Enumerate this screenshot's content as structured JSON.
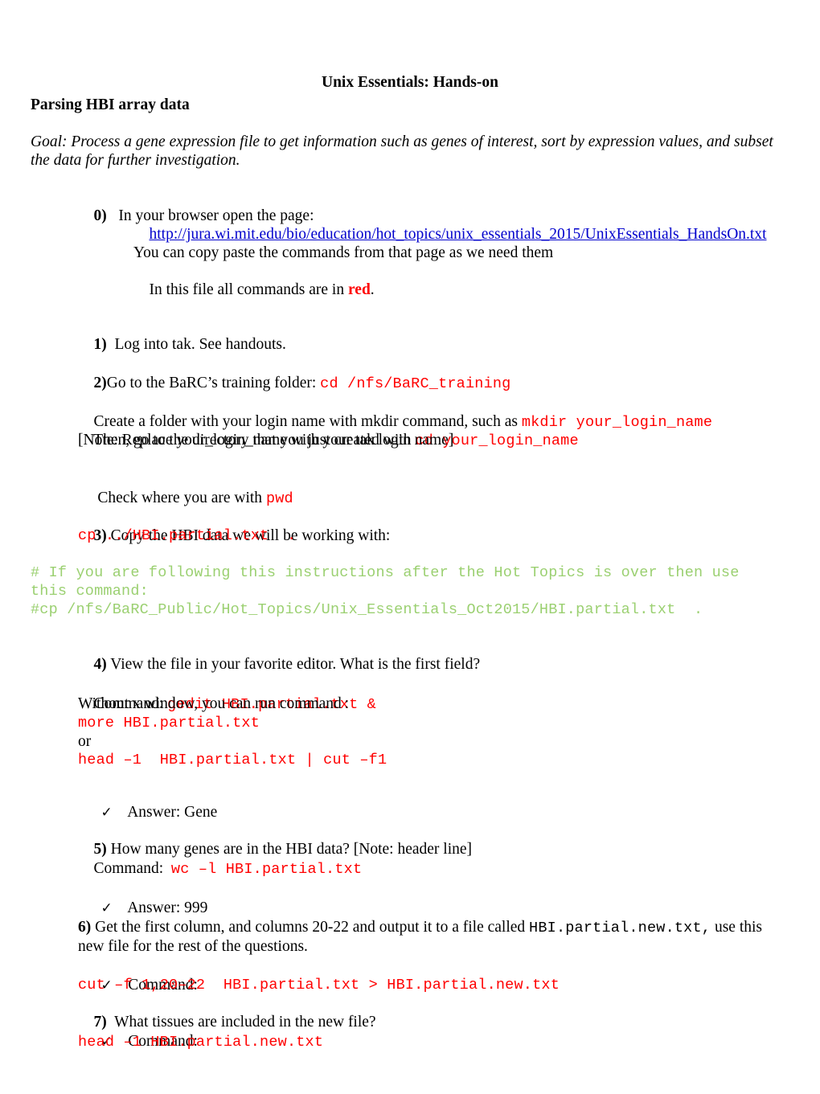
{
  "document": {
    "title": "Unix Essentials: Hands-on",
    "subtitle": "Parsing HBI array data",
    "goal_line1": "Goal: Process a gene expression file to get information such as genes of interest, sort by expression values, and subset",
    "goal_line2": "the data for further investigation."
  },
  "colors": {
    "command_red": "#FF0000",
    "comment_green": "#9BD071",
    "hyperlink_blue": "#0000CC",
    "body_black": "#000000"
  },
  "icons": {
    "checkmark": "✓"
  },
  "steps": {
    "step0": {
      "number": "0)",
      "text": "In your browser open the page:",
      "url": "http://jura.wi.mit.edu/bio/education/hot_topics/unix_essentials_2015/UnixEssentials_HandsOn.txt",
      "note1": "You can copy paste the commands from that page as we need them",
      "note2_prefix": "In this file all commands are in ",
      "note2_red": "red",
      "note2_suffix": "."
    },
    "step1": {
      "number": "1)",
      "text": "Log into tak. See handouts."
    },
    "step2": {
      "number": "2)",
      "text": "Go to the BaRC’s training folder: ",
      "command": "cd /nfs/BaRC_training",
      "line_create_prefix": "Create a folder with your login name with mkdir command, such as ",
      "line_create_cmd": "mkdir your_login_name",
      "line_then_prefix": "Then, go to the directory that you just created with ",
      "line_then_cmd": "cd your_login_name",
      "line_note": "[Note: Replace your_login_name with your tak login name]",
      "line_check_prefix": " Check where you are with ",
      "line_check_cmd": "pwd"
    },
    "step3": {
      "number": "3)",
      "text": "Copy the HBI data we will be working with:",
      "command": "cp ../HBI.partial.txt  .",
      "comment_line1": "# If you are following this instructions after the Hot Topics is over then use",
      "comment_line2": "this command:",
      "comment_line3": "#cp /nfs/BaRC_Public/Hot_Topics/Unix_Essentials_Oct2015/HBI.partial.txt  ."
    },
    "step4": {
      "number": "4)",
      "text": "View the file in your favorite editor. What is the first field?",
      "command_label": "Command: ",
      "command": "gedit HBI.partial.txt &",
      "without_x": "Without x window, you can run command :",
      "command_more": "more HBI.partial.txt",
      "or_label": "or",
      "command_head": "head –1  HBI.partial.txt | cut –f1",
      "answer": "Answer: Gene"
    },
    "step5": {
      "number": "5)",
      "text": "How many genes are in the HBI data? [Note: header line]",
      "command_label": "Command:  ",
      "command": "wc –l HBI.partial.txt",
      "answer": "Answer: 999"
    },
    "step6": {
      "number": "6)",
      "text_part1": "Get the first column, and columns 20-22 and output it to a file called ",
      "text_mono": "HBI.partial.new.txt,",
      "text_part2": " use this",
      "text_line2": "new file for the rest of the questions.",
      "command_label": "Command:",
      "command": "cut –f 1,20–22  HBI.partial.txt > HBI.partial.new.txt"
    },
    "step7": {
      "number": "7)",
      "text": "What tissues are included in the new file?",
      "command_label": "Command:",
      "command": "head –1 HBI.partial.new.txt"
    }
  }
}
